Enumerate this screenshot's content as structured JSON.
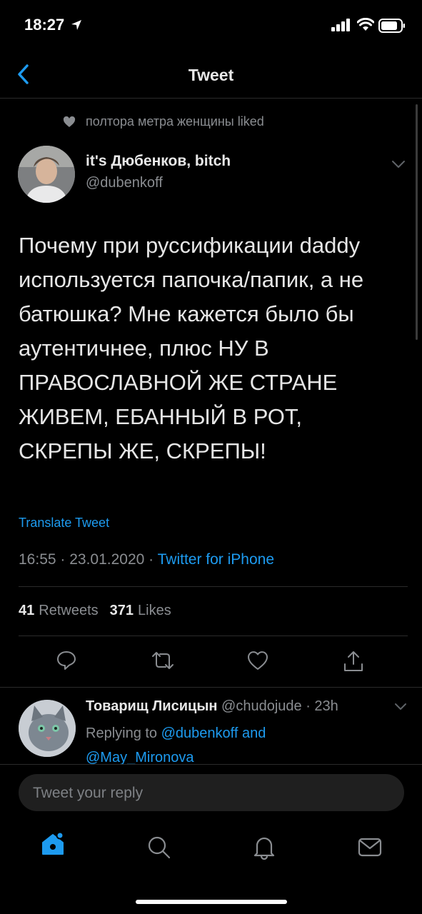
{
  "status_bar": {
    "time": "18:27"
  },
  "nav": {
    "title": "Tweet"
  },
  "social_context": {
    "text": "полтора метра женщины liked"
  },
  "tweet": {
    "author_name": "it's Дюбенков, bitch",
    "author_handle": "@dubenkoff",
    "text": "Почему при руссификации daddy\nиспользуется папочка/папик, а не\nбатюшка? Мне кажется было бы\nаутентичнее, плюс НУ В\nПРАВОСЛАВНОЙ ЖЕ СТРАНЕ\nЖИВЕМ, ЕБАННЫЙ В РОТ,\nСКРЕПЫ ЖЕ, СКРЕПЫ!",
    "translate_label": "Translate Tweet",
    "timestamp": "16:55 · 23.01.2020 · ",
    "source": "Twitter for iPhone",
    "retweets_count": "41",
    "retweets_label": "Retweets",
    "likes_count": "371",
    "likes_label": "Likes"
  },
  "reply": {
    "author_name": "Товарищ Лисицын",
    "author_handle_time": " @chudojude · 23h",
    "replying_prefix": "Replying to ",
    "mention1": "@dubenkoff",
    "and_word": " and ",
    "mention2": "@May_Mironova"
  },
  "compose": {
    "placeholder": "Tweet your reply"
  },
  "tabbar": {
    "items": [
      "home-icon",
      "search-icon",
      "notifications-icon",
      "messages-icon"
    ]
  },
  "colors": {
    "accent": "#1d9bf0",
    "background": "#000000",
    "secondary_text": "#8a8d91"
  }
}
